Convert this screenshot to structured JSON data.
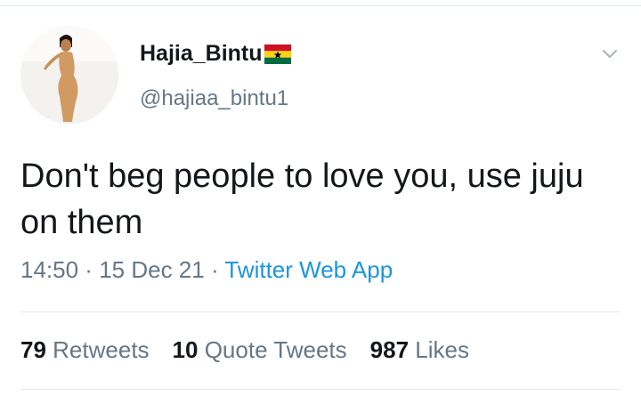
{
  "tweet": {
    "author": {
      "display_name": "Hajia_Bintu",
      "flag_emoji": "ghana-flag",
      "handle": "@hajiaa_bintu1",
      "avatar_icon": "profile-photo"
    },
    "text": "Don't beg people to love you, use juju on them",
    "time": "14:50",
    "date": "15 Dec 21",
    "separator": " · ",
    "source": "Twitter Web App",
    "stats": {
      "retweets_count": "79",
      "retweets_label": "Retweets",
      "quote_tweets_count": "10",
      "quote_tweets_label": "Quote Tweets",
      "likes_count": "987",
      "likes_label": "Likes"
    }
  },
  "colors": {
    "text_primary": "#14171a",
    "text_secondary": "#657786",
    "link": "#1b95e0",
    "divider": "#e1e8ed"
  },
  "icons": {
    "menu": "chevron-down-icon"
  }
}
